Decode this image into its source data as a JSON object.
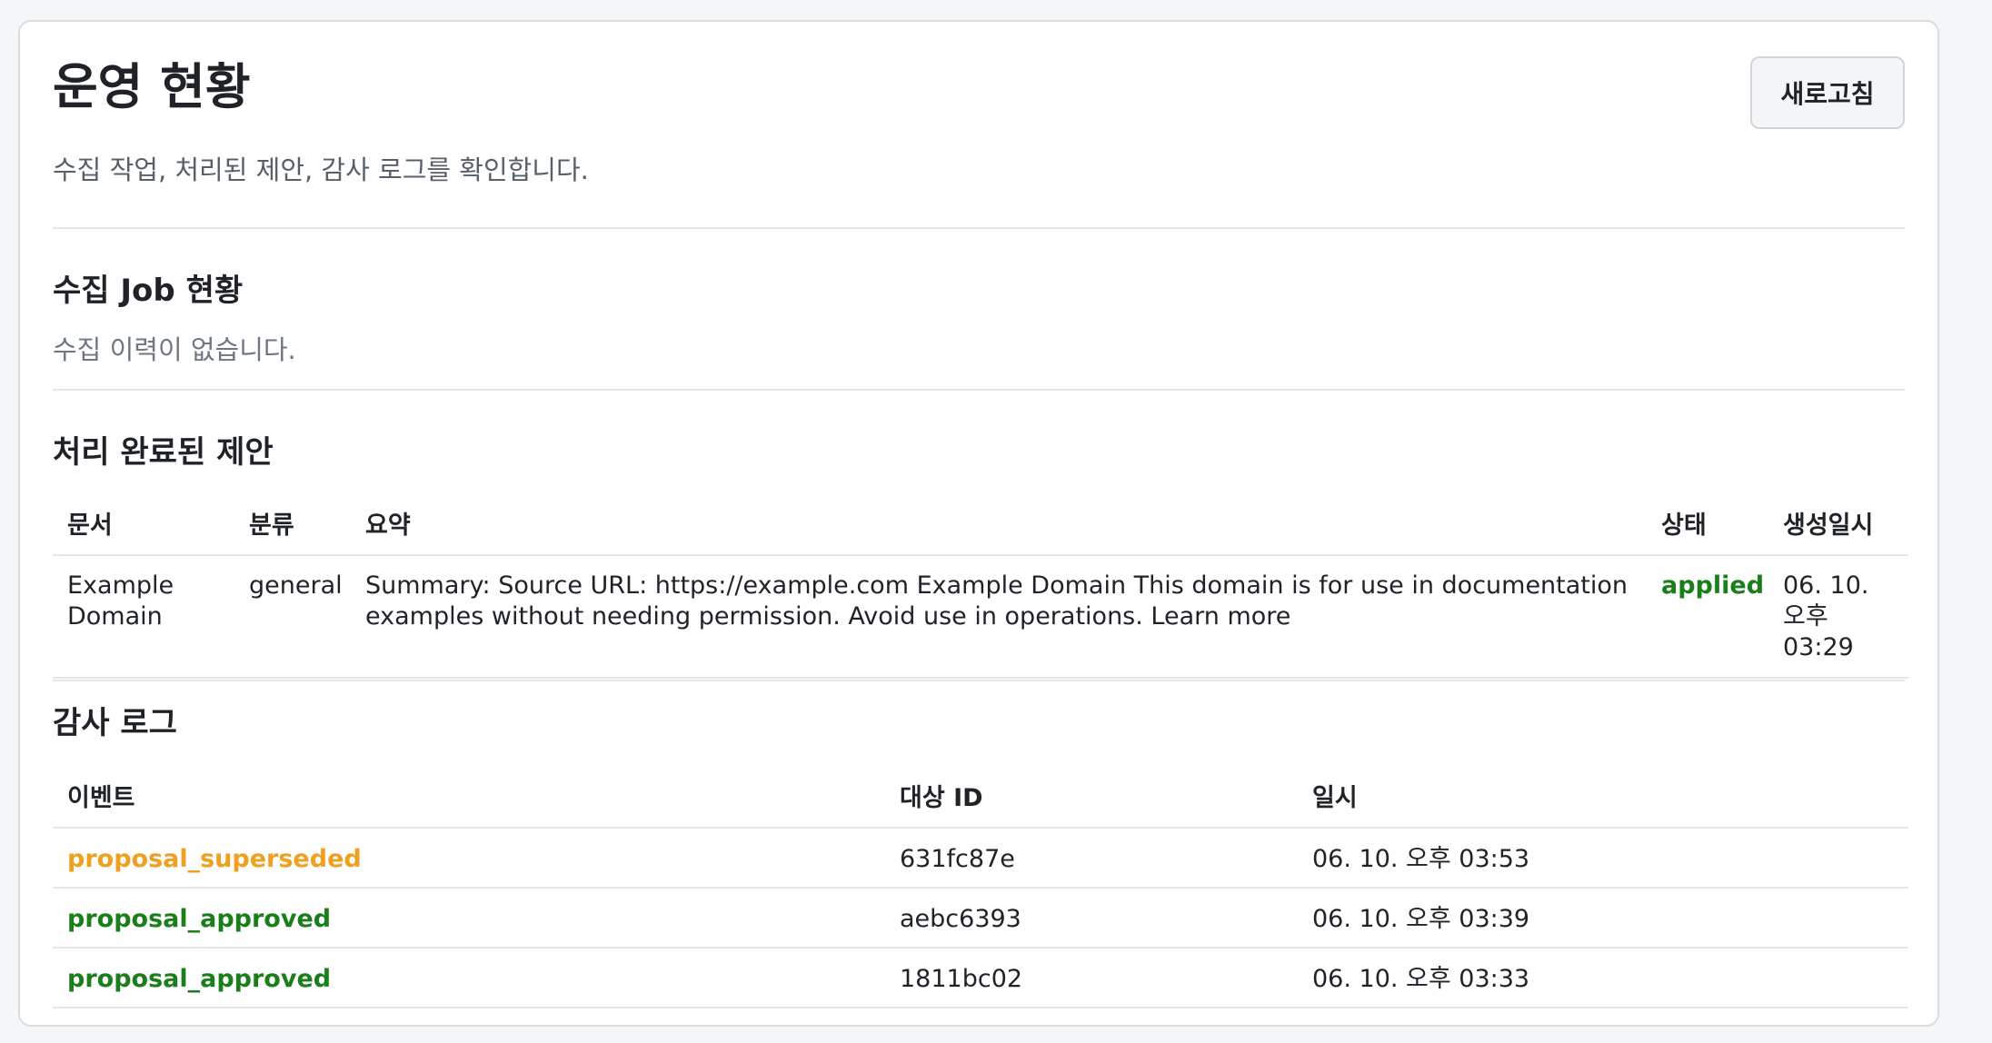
{
  "header": {
    "title": "운영 현황",
    "subtitle": "수집 작업, 처리된 제안, 감사 로그를 확인합니다.",
    "refresh_label": "새로고침"
  },
  "jobs": {
    "title": "수집 Job 현황",
    "empty_text": "수집 이력이 없습니다."
  },
  "proposals": {
    "title": "처리 완료된 제안",
    "columns": [
      "문서",
      "분류",
      "요약",
      "상태",
      "생성일시"
    ],
    "rows": [
      {
        "document": "Example Domain",
        "category": "general",
        "summary": "Summary: Source URL: https://example.com Example Domain This domain is for use in documentation examples without needing permission. Avoid use in operations. Learn more",
        "status": "applied",
        "created": "06. 10. 오후 03:29"
      }
    ]
  },
  "audit": {
    "title": "감사 로그",
    "columns": [
      "이벤트",
      "대상 ID",
      "일시"
    ],
    "rows": [
      {
        "event": "proposal_superseded",
        "target": "631fc87e",
        "time": "06. 10. 오후 03:53"
      },
      {
        "event": "proposal_approved",
        "target": "aebc6393",
        "time": "06. 10. 오후 03:39"
      },
      {
        "event": "proposal_approved",
        "target": "1811bc02",
        "time": "06. 10. 오후 03:33"
      }
    ]
  },
  "colors": {
    "applied": "#1a7f1a",
    "superseded": "#f0a020",
    "approved": "#1a7f1a"
  }
}
